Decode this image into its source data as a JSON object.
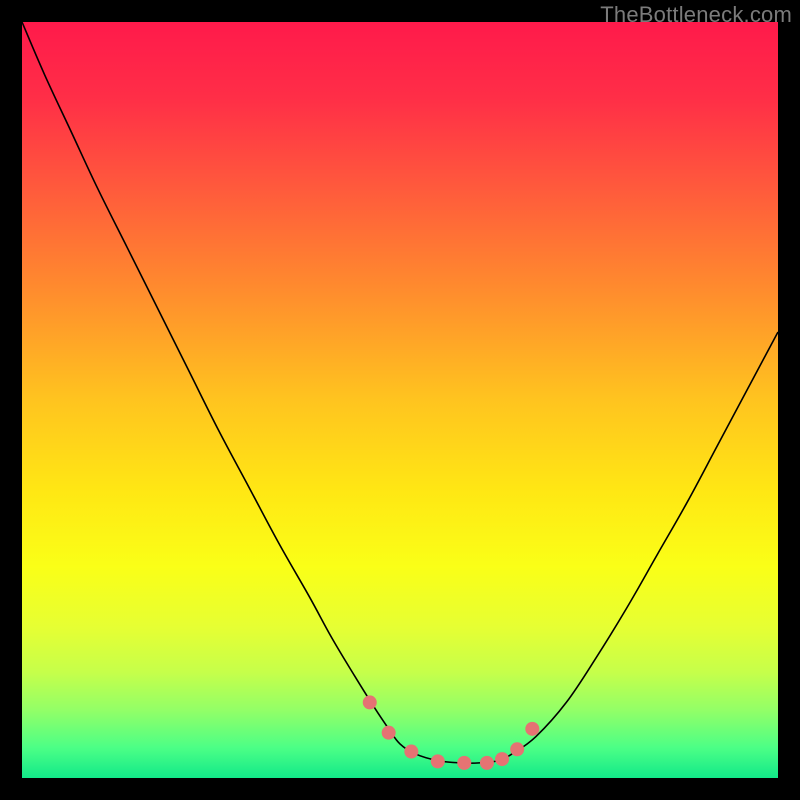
{
  "watermark": "TheBottleneck.com",
  "chart_data": {
    "type": "line",
    "title": "",
    "xlabel": "",
    "ylabel": "",
    "xlim": [
      0,
      100
    ],
    "ylim": [
      0,
      100
    ],
    "legend": false,
    "background_gradient": {
      "stops": [
        {
          "offset": 0.0,
          "color": "#ff1a4b"
        },
        {
          "offset": 0.1,
          "color": "#ff2e47"
        },
        {
          "offset": 0.22,
          "color": "#ff5a3c"
        },
        {
          "offset": 0.35,
          "color": "#ff8a2e"
        },
        {
          "offset": 0.5,
          "color": "#ffc41f"
        },
        {
          "offset": 0.62,
          "color": "#ffe714"
        },
        {
          "offset": 0.72,
          "color": "#faff17"
        },
        {
          "offset": 0.8,
          "color": "#e6ff33"
        },
        {
          "offset": 0.86,
          "color": "#c6ff4a"
        },
        {
          "offset": 0.91,
          "color": "#93ff67"
        },
        {
          "offset": 0.96,
          "color": "#4cff86"
        },
        {
          "offset": 1.0,
          "color": "#12e989"
        }
      ]
    },
    "series": [
      {
        "name": "bottleneck-curve",
        "color": "#000000",
        "width": 1.6,
        "x": [
          0.0,
          3.0,
          6.5,
          10.0,
          14.0,
          18.0,
          22.0,
          26.0,
          30.0,
          34.0,
          38.0,
          41.0,
          44.0,
          46.5,
          48.5,
          50.0,
          52.0,
          55.0,
          58.0,
          60.5,
          63.0,
          65.0,
          68.0,
          72.0,
          76.0,
          80.0,
          84.0,
          88.0,
          92.0,
          96.0,
          100.0
        ],
        "y": [
          100.0,
          93.0,
          85.5,
          78.0,
          70.0,
          62.0,
          54.0,
          46.0,
          38.5,
          31.0,
          24.0,
          18.5,
          13.5,
          9.5,
          6.5,
          4.5,
          3.2,
          2.3,
          2.0,
          2.0,
          2.3,
          3.3,
          5.5,
          10.0,
          16.0,
          22.5,
          29.5,
          36.5,
          44.0,
          51.5,
          59.0
        ]
      }
    ],
    "markers": {
      "name": "highlight-points",
      "color": "#e57373",
      "radius": 7,
      "x": [
        46.0,
        48.5,
        51.5,
        55.0,
        58.5,
        61.5,
        63.5,
        65.5,
        67.5
      ],
      "y": [
        10.0,
        6.0,
        3.5,
        2.2,
        2.0,
        2.0,
        2.5,
        3.8,
        6.5
      ]
    }
  }
}
